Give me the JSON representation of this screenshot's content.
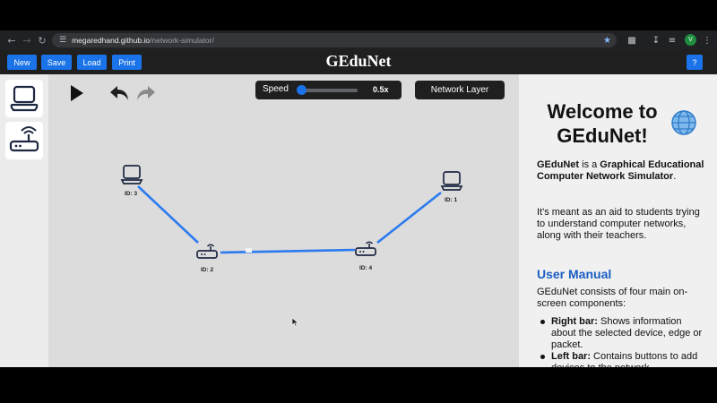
{
  "browser": {
    "url_host": "megaredhand.github.io",
    "url_path": "/network-simulator/",
    "profile_initial": "V"
  },
  "toolbar": {
    "new_label": "New",
    "save_label": "Save",
    "load_label": "Load",
    "print_label": "Print",
    "help_label": "?",
    "title": "GEduNet"
  },
  "canvas": {
    "speed_label": "Speed",
    "speed_value": "0.5x",
    "speed_fraction": 0.0,
    "layer_button": "Network Layer",
    "nodes": [
      {
        "label": "ID: 3",
        "type": "host"
      },
      {
        "label": "ID: 1",
        "type": "host"
      },
      {
        "label": "ID: 2",
        "type": "router"
      },
      {
        "label": "ID: 4",
        "type": "router"
      }
    ]
  },
  "rightbar": {
    "welcome": "Welcome to GEduNet!",
    "intro_name": "GEduNet",
    "intro_is": " is a ",
    "intro_desc": "Graphical Educational Computer Network Simulator",
    "intro_end": ".",
    "paragraph2": "It's meant as an aid to students trying to understand computer networks, along with their teachers.",
    "manual_heading": "User Manual",
    "manual_intro": "GEduNet consists of four main on-screen components:",
    "items": [
      {
        "term": "Right bar:",
        "desc": " Shows information about the selected device, edge or packet."
      },
      {
        "term": "Left bar:",
        "desc": " Contains buttons to add devices to the network."
      }
    ]
  }
}
